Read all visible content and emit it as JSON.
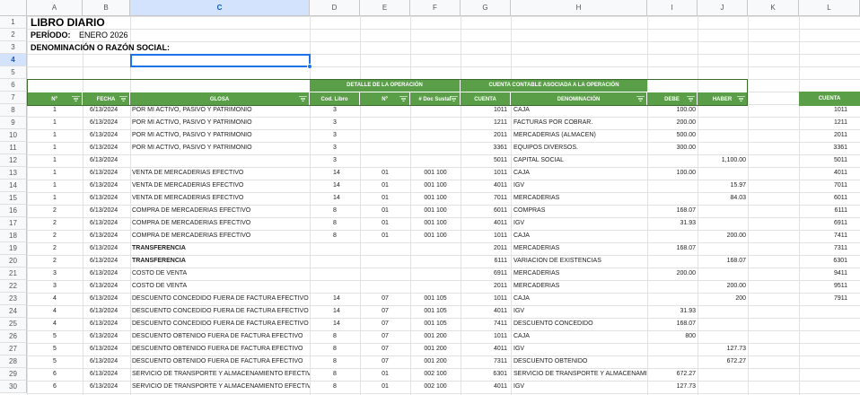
{
  "columns": [
    "A",
    "B",
    "C",
    "D",
    "E",
    "F",
    "G",
    "H",
    "I",
    "J",
    "K",
    "L"
  ],
  "rows": [
    "1",
    "2",
    "3",
    "4",
    "5",
    "6",
    "7",
    "8",
    "9",
    "10",
    "11",
    "12",
    "13",
    "14",
    "15",
    "16",
    "17",
    "18",
    "19",
    "20",
    "21",
    "22",
    "23",
    "24",
    "25",
    "26",
    "27",
    "28",
    "29",
    "30"
  ],
  "title": "LIBRO DIARIO",
  "period_label": "PERÍODO:",
  "period_value": "ENERO 2026",
  "denomination_label": "DENOMINACIÓN O RAZÓN SOCIAL:",
  "group_headers": {
    "detalle": "DETALLE DE LA OPERACIÓN",
    "cuenta_contable": "CUENTA CONTABLE ASOCIADA A LA OPERACIÓN"
  },
  "headers": {
    "n": "Nº",
    "fecha": "FECHA",
    "glosa": "GLOSA",
    "cod_libro": "Cod. Libro",
    "n2": "Nº",
    "doc": "# Doc Sustat",
    "cuenta": "CUENTA",
    "denominacion": "DENOMINACIÓN",
    "debe": "DEBE",
    "haber": "HABER",
    "cuenta_l": "CUENTA"
  },
  "entries": [
    {
      "n": "1",
      "fecha": "6/13/2024",
      "glosa": "POR MI ACTIVO, PASIVO Y PATRIMONIO",
      "cod": "3",
      "n2": "",
      "doc": "",
      "cuenta": "1011",
      "denom": "CAJA",
      "debe": "100.00",
      "haber": "",
      "cuenta_l": "1011",
      "bold": false
    },
    {
      "n": "1",
      "fecha": "6/13/2024",
      "glosa": "POR MI ACTIVO, PASIVO Y PATRIMONIO",
      "cod": "3",
      "n2": "",
      "doc": "",
      "cuenta": "1211",
      "denom": "FACTURAS POR COBRAR.",
      "debe": "200.00",
      "haber": "",
      "cuenta_l": "1211",
      "bold": false
    },
    {
      "n": "1",
      "fecha": "6/13/2024",
      "glosa": "POR MI ACTIVO, PASIVO Y PATRIMONIO",
      "cod": "3",
      "n2": "",
      "doc": "",
      "cuenta": "2011",
      "denom": "MERCADERIAS (ALMACEN)",
      "debe": "500.00",
      "haber": "",
      "cuenta_l": "2011",
      "bold": false
    },
    {
      "n": "1",
      "fecha": "6/13/2024",
      "glosa": "POR MI ACTIVO, PASIVO Y PATRIMONIO",
      "cod": "3",
      "n2": "",
      "doc": "",
      "cuenta": "3361",
      "denom": "EQUIPOS DIVERSOS.",
      "debe": "300.00",
      "haber": "",
      "cuenta_l": "3361",
      "bold": false
    },
    {
      "n": "1",
      "fecha": "6/13/2024",
      "glosa": "",
      "cod": "3",
      "n2": "",
      "doc": "",
      "cuenta": "5011",
      "denom": "CAPITAL SOCIAL",
      "debe": "",
      "haber": "1,100.00",
      "cuenta_l": "5011",
      "bold": false
    },
    {
      "n": "1",
      "fecha": "6/13/2024",
      "glosa": "VENTA DE MERCADERIAS EFECTIVO",
      "cod": "14",
      "n2": "01",
      "doc": "001 100",
      "cuenta": "1011",
      "denom": "CAJA",
      "debe": "100.00",
      "haber": "",
      "cuenta_l": "4011",
      "bold": false
    },
    {
      "n": "1",
      "fecha": "6/13/2024",
      "glosa": "VENTA DE MERCADERIAS EFECTIVO",
      "cod": "14",
      "n2": "01",
      "doc": "001 100",
      "cuenta": "4011",
      "denom": "IGV",
      "debe": "",
      "haber": "15.97",
      "cuenta_l": "7011",
      "bold": false
    },
    {
      "n": "1",
      "fecha": "6/13/2024",
      "glosa": "VENTA DE MERCADERIAS EFECTIVO",
      "cod": "14",
      "n2": "01",
      "doc": "001 100",
      "cuenta": "7011",
      "denom": "MERCADERIAS",
      "debe": "",
      "haber": "84.03",
      "cuenta_l": "6011",
      "bold": false
    },
    {
      "n": "2",
      "fecha": "6/13/2024",
      "glosa": "COMPRA DE MERCADERIAS EFECTIVO",
      "cod": "8",
      "n2": "01",
      "doc": "001 100",
      "cuenta": "6011",
      "denom": "COMPRAS",
      "debe": "168.07",
      "haber": "",
      "cuenta_l": "6111",
      "bold": false
    },
    {
      "n": "2",
      "fecha": "6/13/2024",
      "glosa": "COMPRA DE MERCADERIAS EFECTIVO",
      "cod": "8",
      "n2": "01",
      "doc": "001 100",
      "cuenta": "4011",
      "denom": "IGV",
      "debe": "31.93",
      "haber": "",
      "cuenta_l": "6911",
      "bold": false
    },
    {
      "n": "2",
      "fecha": "6/13/2024",
      "glosa": "COMPRA DE MERCADERIAS EFECTIVO",
      "cod": "8",
      "n2": "01",
      "doc": "001 100",
      "cuenta": "1011",
      "denom": "CAJA",
      "debe": "",
      "haber": "200.00",
      "cuenta_l": "7411",
      "bold": false
    },
    {
      "n": "2",
      "fecha": "6/13/2024",
      "glosa": "TRANSFERENCIA",
      "cod": "",
      "n2": "",
      "doc": "",
      "cuenta": "2011",
      "denom": "MERCADERIAS",
      "debe": "168.07",
      "haber": "",
      "cuenta_l": "7311",
      "bold": true
    },
    {
      "n": "2",
      "fecha": "6/13/2024",
      "glosa": "TRANSFERENCIA",
      "cod": "",
      "n2": "",
      "doc": "",
      "cuenta": "6111",
      "denom": "VARIACION DE EXISTENCIAS",
      "debe": "",
      "haber": "168.07",
      "cuenta_l": "6301",
      "bold": true
    },
    {
      "n": "3",
      "fecha": "6/13/2024",
      "glosa": "COSTO DE VENTA",
      "cod": "",
      "n2": "",
      "doc": "",
      "cuenta": "6911",
      "denom": "MERCADERIAS",
      "debe": "200.00",
      "haber": "",
      "cuenta_l": "9411",
      "bold": false
    },
    {
      "n": "3",
      "fecha": "6/13/2024",
      "glosa": "COSTO DE VENTA",
      "cod": "",
      "n2": "",
      "doc": "",
      "cuenta": "2011",
      "denom": "MERCADERIAS",
      "debe": "",
      "haber": "200.00",
      "cuenta_l": "9511",
      "bold": false
    },
    {
      "n": "4",
      "fecha": "6/13/2024",
      "glosa": "DESCUENTO CONCEDIDO FUERA DE FACTURA EFECTIVO",
      "cod": "14",
      "n2": "07",
      "doc": "001 105",
      "cuenta": "1011",
      "denom": "CAJA",
      "debe": "",
      "haber": "200",
      "cuenta_l": "7911",
      "bold": false
    },
    {
      "n": "4",
      "fecha": "6/13/2024",
      "glosa": "DESCUENTO CONCEDIDO FUERA DE FACTURA EFECTIVO",
      "cod": "14",
      "n2": "07",
      "doc": "001 105",
      "cuenta": "4011",
      "denom": "IGV",
      "debe": "31.93",
      "haber": "",
      "cuenta_l": "",
      "bold": false
    },
    {
      "n": "4",
      "fecha": "6/13/2024",
      "glosa": "DESCUENTO CONCEDIDO FUERA DE FACTURA EFECTIVO",
      "cod": "14",
      "n2": "07",
      "doc": "001 105",
      "cuenta": "7411",
      "denom": "DESCUENTO CONCEDIDO",
      "debe": "168.07",
      "haber": "",
      "cuenta_l": "",
      "bold": false
    },
    {
      "n": "5",
      "fecha": "6/13/2024",
      "glosa": "DESCUENTO OBTENIDO FUERA DE FACTURA EFECTIVO",
      "cod": "8",
      "n2": "07",
      "doc": "001 200",
      "cuenta": "1011",
      "denom": "CAJA",
      "debe": "800",
      "haber": "",
      "cuenta_l": "",
      "bold": false
    },
    {
      "n": "5",
      "fecha": "6/13/2024",
      "glosa": "DESCUENTO OBTENIDO FUERA DE FACTURA EFECTIVO",
      "cod": "8",
      "n2": "07",
      "doc": "001 200",
      "cuenta": "4011",
      "denom": "IGV",
      "debe": "",
      "haber": "127.73",
      "cuenta_l": "",
      "bold": false
    },
    {
      "n": "5",
      "fecha": "6/13/2024",
      "glosa": "DESCUENTO OBTENIDO FUERA DE FACTURA EFECTIVO",
      "cod": "8",
      "n2": "07",
      "doc": "001 200",
      "cuenta": "7311",
      "denom": "DESCUENTO OBTENIDO",
      "debe": "",
      "haber": "672.27",
      "cuenta_l": "",
      "bold": false
    },
    {
      "n": "6",
      "fecha": "6/13/2024",
      "glosa": "SERVICIO DE TRANSPORTE Y ALMACENAMIENTO EFECTIVO",
      "cod": "8",
      "n2": "01",
      "doc": "002 100",
      "cuenta": "6301",
      "denom": "SERVICIO DE TRANSPORTE Y ALMACENAMIEN'",
      "debe": "672.27",
      "haber": "",
      "cuenta_l": "",
      "bold": false
    },
    {
      "n": "6",
      "fecha": "6/13/2024",
      "glosa": "SERVICIO DE TRANSPORTE Y ALMACENAMIENTO EFECTIVO",
      "cod": "8",
      "n2": "01",
      "doc": "002 100",
      "cuenta": "4011",
      "denom": "IGV",
      "debe": "127.73",
      "haber": "",
      "cuenta_l": "",
      "bold": false
    }
  ]
}
